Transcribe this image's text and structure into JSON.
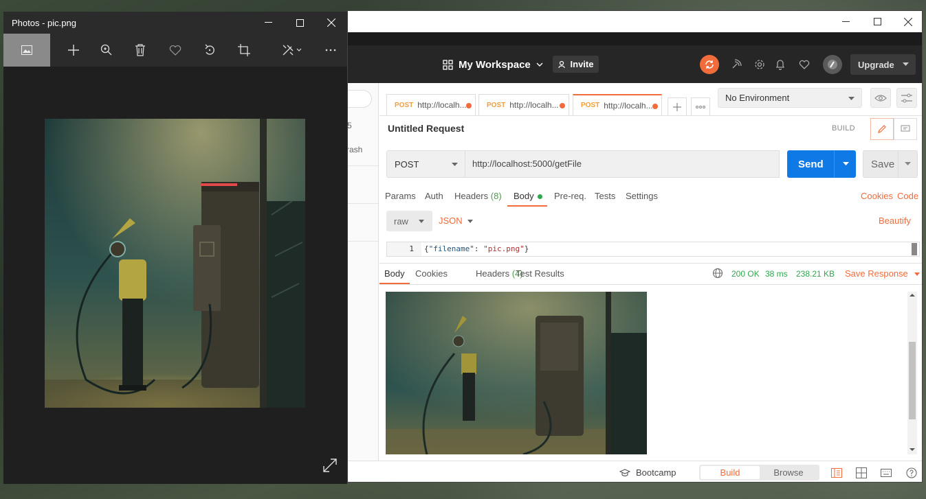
{
  "photos": {
    "title": "Photos - pic.png",
    "toolbar": [
      "image-icon",
      "add-icon",
      "zoom-icon",
      "delete-icon",
      "heart-icon",
      "rotate-icon",
      "crop-icon",
      "edit-icon",
      "more-icon"
    ]
  },
  "postman": {
    "workspace": "My Workspace",
    "invite": "Invite",
    "upgrade": "Upgrade",
    "sidebar": {
      "partial_label": "rash"
    },
    "tabs": [
      {
        "method": "POST",
        "url": "http://localh..."
      },
      {
        "method": "POST",
        "url": "http://localh..."
      },
      {
        "method": "POST",
        "url": "http://localh..."
      }
    ],
    "environment": "No Environment",
    "request_title": "Untitled Request",
    "build_label": "BUILD",
    "method": "POST",
    "url": "http://localhost:5000/getFile",
    "send": "Send",
    "save": "Save",
    "request_tabs": {
      "params": "Params",
      "auth": "Auth",
      "headers": "Headers",
      "headers_count": "(8)",
      "body": "Body",
      "prereq": "Pre-req.",
      "tests": "Tests",
      "settings": "Settings"
    },
    "cookies_link": "Cookies",
    "code_link": "Code",
    "body_mode": "raw",
    "body_lang": "JSON",
    "beautify": "Beautify",
    "editor": {
      "line_number": "1",
      "open_brace": "{",
      "key": "\"filename\"",
      "colon": ": ",
      "value": "\"pic.png\"",
      "close_brace": "}"
    },
    "response_tabs": {
      "body": "Body",
      "cookies": "Cookies",
      "headers": "Headers",
      "headers_count": "(4)",
      "test_results": "Test Results"
    },
    "response_status": "200 OK",
    "response_time": "38 ms",
    "response_size": "238.21 KB",
    "save_response": "Save Response",
    "statusbar": {
      "bootcamp": "Bootcamp",
      "build": "Build",
      "browse": "Browse"
    },
    "colors": {
      "accent": "#f26b3a",
      "send": "#0f7ae5",
      "ok": "#2fa74c"
    }
  }
}
